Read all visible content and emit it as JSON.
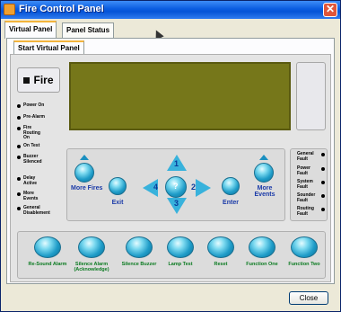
{
  "window": {
    "title": "Fire Control Panel",
    "close_glyph": "✕"
  },
  "tabs": [
    {
      "label": "Virtual Panel",
      "active": true
    },
    {
      "label": "Panel Status",
      "active": false
    }
  ],
  "subtab": {
    "label": "Start Virtual Panel"
  },
  "fire_button": {
    "label": "Fire"
  },
  "left_indicators": [
    "Power On",
    "Pre-Alarm",
    "Fire Routing On",
    "On Test",
    "Buzzer Silenced",
    "Delay Active",
    "More Events",
    "General Disablement"
  ],
  "right_indicators": [
    "General Fault",
    "Power Fault",
    "System Fault",
    "Sounder Fault",
    "Routing Fault"
  ],
  "nav": {
    "more_fires": "More Fires",
    "exit": "Exit",
    "enter": "Enter",
    "more_events": "More Events",
    "up_num": "1",
    "left_num": "4",
    "center_num": "?",
    "right_num": "2",
    "down_num": "3"
  },
  "function_buttons": [
    "Re-Sound Alarm",
    "Silence Alarm (Acknowledge)",
    "Silence Buzzer",
    "Lamp Test",
    "Reset",
    "Function One",
    "Function Two"
  ],
  "footer": {
    "close_label": "Close"
  },
  "colors": {
    "lcd": "#76771a",
    "button_blue": "#1f9cc8",
    "label_green": "#0a7a20",
    "title_blue": "#0553d6"
  }
}
